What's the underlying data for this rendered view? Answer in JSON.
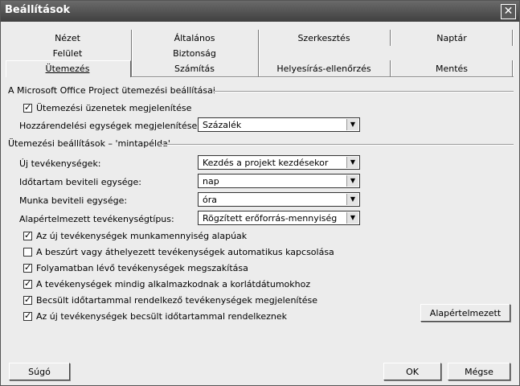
{
  "window": {
    "title": "Beállítások"
  },
  "tabs": {
    "row1": [
      "Nézet",
      "Általános",
      "Szerkesztés",
      "Naptár"
    ],
    "row2": [
      "Felület",
      "Biztonság"
    ],
    "row3": [
      "Ütemezés",
      "Számítás",
      "Helyesírás-ellenőrzés",
      "Mentés"
    ]
  },
  "section1": {
    "title": "A Microsoft Office Project ütemezési beállításai",
    "show_messages": {
      "label": "Ütemezési üzenetek megjelenítése",
      "checked": true
    },
    "assignment_units": {
      "label": "Hozzárendelési egységek megjelenítése mint:",
      "value": "Százalék"
    }
  },
  "section2": {
    "title": "Ütemezési beállítások – 'mintapélda'",
    "fields": [
      {
        "label": "Új tevékenységek:",
        "value": "Kezdés a projekt kezdésekor"
      },
      {
        "label": "Időtartam beviteli egysége:",
        "value": "nap"
      },
      {
        "label": "Munka beviteli egysége:",
        "value": "óra"
      },
      {
        "label": "Alapértelmezett tevékenységtípus:",
        "value": "Rögzített erőforrás-mennyiség"
      }
    ],
    "checkboxes": [
      {
        "label": "Az új tevékenységek munkamennyiség alapúak",
        "checked": true
      },
      {
        "label": "A beszúrt vagy áthelyezett tevékenységek automatikus kapcsolása",
        "checked": false
      },
      {
        "label": "Folyamatban lévő tevékenységek megszakítása",
        "checked": true
      },
      {
        "label": "A tevékenységek mindig alkalmazkodnak a korlátdátumokhoz",
        "checked": true
      },
      {
        "label": "Becsült időtartammal rendelkező tevékenységek megjelenítése",
        "checked": true
      },
      {
        "label": "Az új tevékenységek becsült időtartammal rendelkeznek",
        "checked": true
      }
    ],
    "default_button": "Alapértelmezett"
  },
  "footer": {
    "help": "Súgó",
    "ok": "OK",
    "cancel": "Mégse"
  }
}
